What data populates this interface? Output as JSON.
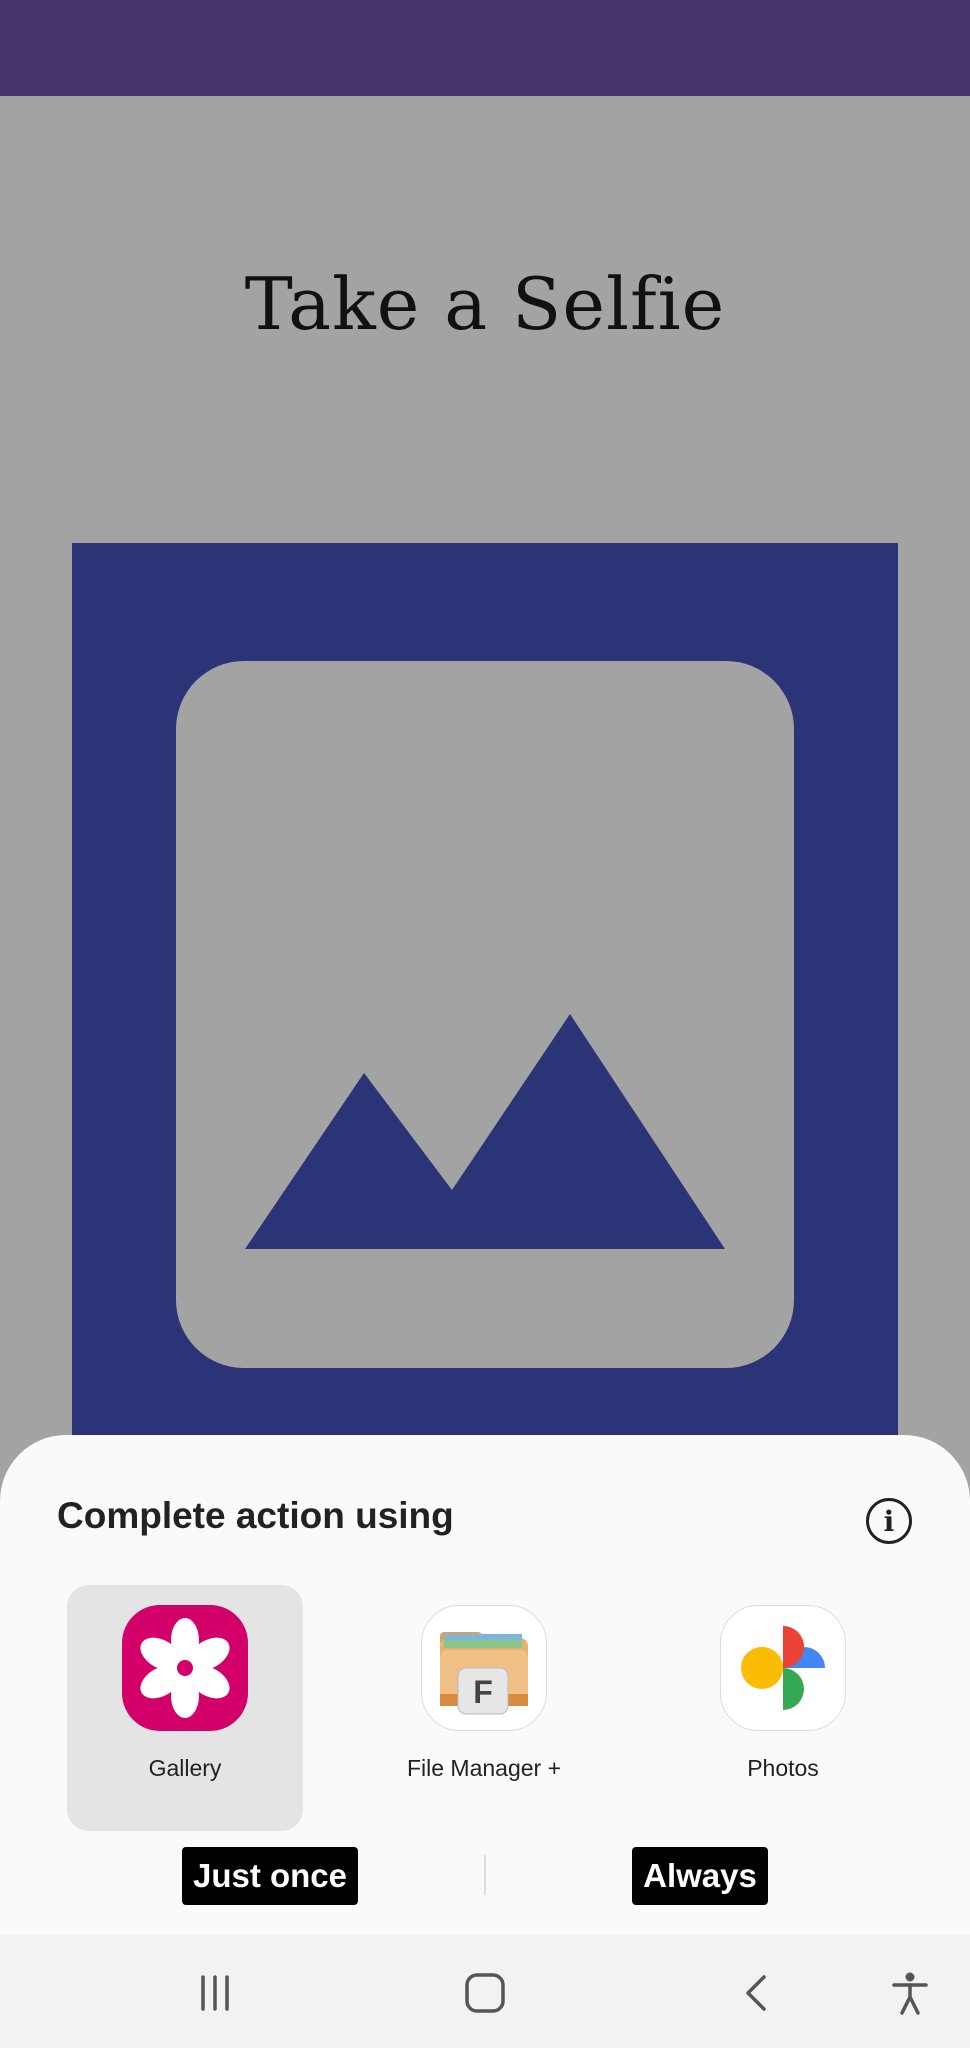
{
  "screen": {
    "title": "Take a Selfie"
  },
  "sheet": {
    "title": "Complete action using",
    "info_glyph": "i",
    "apps": [
      {
        "label": "Gallery",
        "icon": "gallery-flower-icon",
        "selected": true
      },
      {
        "label": "File Manager +",
        "icon": "folder-f-icon",
        "selected": false
      },
      {
        "label": "Photos",
        "icon": "pinwheel-icon",
        "selected": false
      }
    ],
    "just_once_label": "Just once",
    "always_label": "Always"
  },
  "nav": {
    "icons": [
      "recent-apps-icon",
      "home-icon",
      "back-icon",
      "accessibility-icon"
    ]
  },
  "colors": {
    "status_bar": "#45356c",
    "background": "#a4a3a4",
    "image_frame": "#2b3476",
    "gallery_pink": "#d4006a"
  }
}
